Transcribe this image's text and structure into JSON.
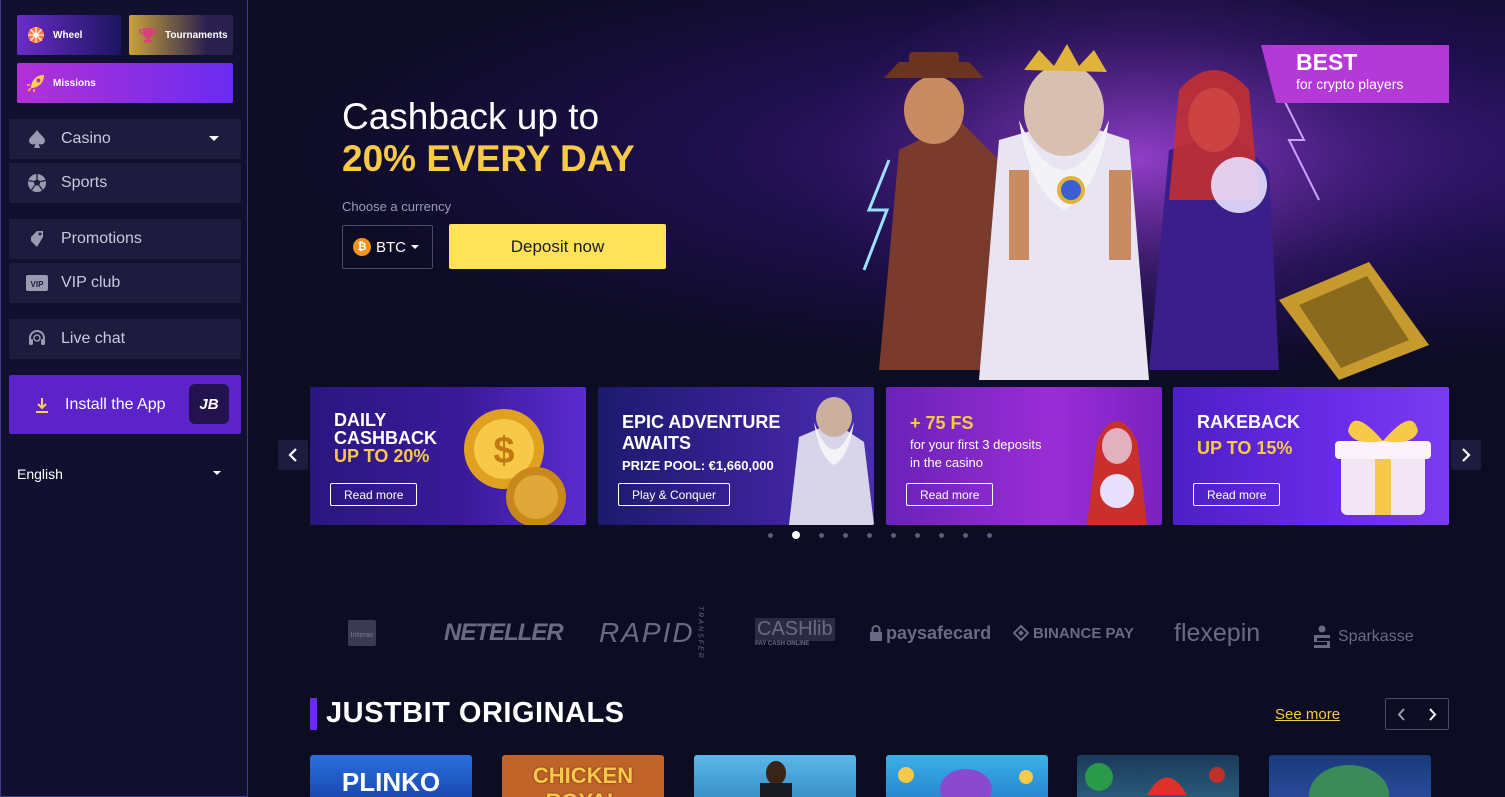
{
  "sidebar": {
    "quick": {
      "wheel": "Wheel",
      "tournaments": "Tournaments",
      "missions": "Missions"
    },
    "nav": {
      "casino": "Casino",
      "sports": "Sports",
      "promotions": "Promotions",
      "vip": "VIP club",
      "live_chat": "Live chat"
    },
    "install": {
      "label": "Install the App",
      "badge": "JB"
    },
    "language": "English"
  },
  "hero": {
    "title_line1": "Cashback up to",
    "title_line2": "20% EVERY DAY",
    "choose_label": "Choose a currency",
    "currency": "BTC",
    "currency_symbol": "₿",
    "deposit_label": "Deposit now",
    "badge_title": "BEST",
    "badge_sub": "for crypto players"
  },
  "promos": [
    {
      "line1": "DAILY",
      "line2": "CASHBACK",
      "line3": "UP TO 20%",
      "button": "Read more"
    },
    {
      "line1": "EPIC ADVENTURE",
      "line2": "AWAITS",
      "sub": "PRIZE POOL: €1,660,000",
      "button": "Play & Conquer"
    },
    {
      "line1": "+ 75 FS",
      "sub1": "for your first 3 deposits",
      "sub2": "in the casino",
      "button": "Read more"
    },
    {
      "line1": "RAKEBACK",
      "line2": "UP TO 15%",
      "button": "Read more"
    }
  ],
  "carousel": {
    "dot_count": 10,
    "active_index": 1
  },
  "payments": {
    "interac": "Interac",
    "neteller": "NETELLER",
    "rapid": "RAPID",
    "rapid_sub": "TRANSFER",
    "cashlib": "CASHlib",
    "cashlib_sub": "PAY CASH ONLINE",
    "paysafecard": "paysafecard",
    "binance": "BINANCE PAY",
    "flexepin": "flexepin",
    "sparkasse": "Sparkasse"
  },
  "originals": {
    "title": "JUSTBIT ORIGINALS",
    "see_more": "See more",
    "games": [
      "PLINKO",
      "CHICKEN ROYAL",
      "",
      "",
      "",
      ""
    ]
  },
  "colors": {
    "accent_yellow": "#f7c948",
    "accent_purple": "#6a2ce8",
    "sidebar_bg": "#111030",
    "page_bg": "#0c0c22"
  }
}
